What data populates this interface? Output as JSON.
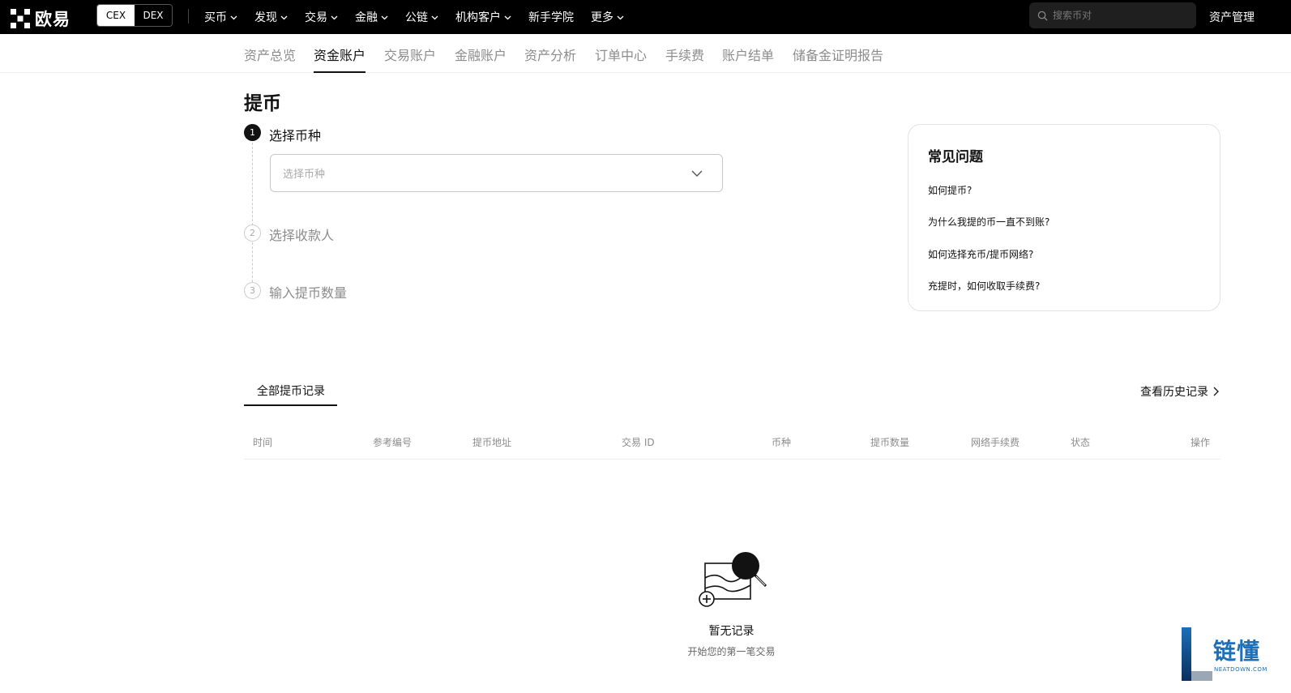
{
  "brand": {
    "name": "欧易"
  },
  "mode_toggle": {
    "cex": "CEX",
    "dex": "DEX"
  },
  "nav": [
    {
      "label": "买币",
      "has_dropdown": true
    },
    {
      "label": "发现",
      "has_dropdown": true
    },
    {
      "label": "交易",
      "has_dropdown": true
    },
    {
      "label": "金融",
      "has_dropdown": true
    },
    {
      "label": "公链",
      "has_dropdown": true
    },
    {
      "label": "机构客户",
      "has_dropdown": true
    },
    {
      "label": "新手学院",
      "has_dropdown": false
    },
    {
      "label": "更多",
      "has_dropdown": true
    }
  ],
  "search": {
    "placeholder": "搜索币对"
  },
  "asset_management": "资产管理",
  "subnav": [
    {
      "label": "资产总览",
      "active": false
    },
    {
      "label": "资金账户",
      "active": true
    },
    {
      "label": "交易账户",
      "active": false
    },
    {
      "label": "金融账户",
      "active": false
    },
    {
      "label": "资产分析",
      "active": false
    },
    {
      "label": "订单中心",
      "active": false
    },
    {
      "label": "手续费",
      "active": false
    },
    {
      "label": "账户结单",
      "active": false
    },
    {
      "label": "储备金证明报告",
      "active": false
    }
  ],
  "page_title": "提币",
  "steps": [
    {
      "number": "1",
      "label": "选择币种",
      "active": true
    },
    {
      "number": "2",
      "label": "选择收款人",
      "active": false
    },
    {
      "number": "3",
      "label": "输入提币数量",
      "active": false
    }
  ],
  "coin_select": {
    "placeholder": "选择币种"
  },
  "faq": {
    "title": "常见问题",
    "items": [
      "如何提币?",
      "为什么我提的币一直不到账?",
      "如何选择充币/提币网络?",
      "充提时，如何收取手续费?"
    ]
  },
  "records": {
    "tab": "全部提币记录",
    "history_link": "查看历史记录",
    "columns": [
      "时间",
      "参考编号",
      "提币地址",
      "交易 ID",
      "币种",
      "提币数量",
      "网络手续费",
      "状态",
      "操作"
    ],
    "empty_title": "暂无记录",
    "empty_subtitle": "开始您的第一笔交易"
  },
  "watermark": {
    "text": "链懂",
    "sub": "NEATDOWN.COM"
  },
  "colors": {
    "topbar": "#000000",
    "text": "#121212",
    "muted": "#8c8c8c",
    "watermark": "#1d6fb8"
  }
}
